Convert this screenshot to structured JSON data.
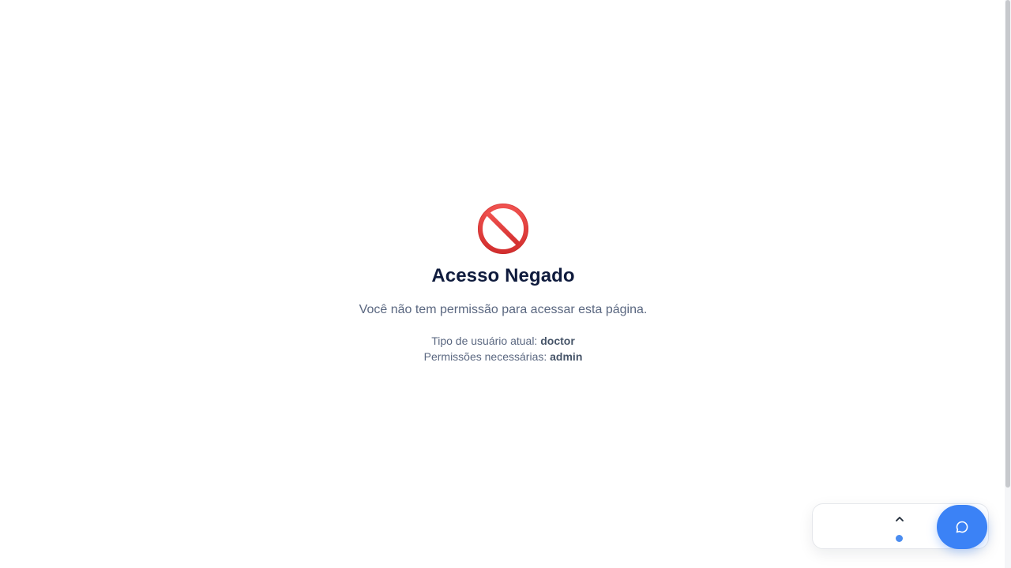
{
  "error": {
    "icon": "prohibited-icon",
    "title": "Acesso Negado",
    "message": "Você não tem permissão para acessar esta página.",
    "user_type_label": "Tipo de usuário atual:",
    "user_type_value": "doctor",
    "permissions_label": "Permissões necessárias:",
    "permissions_value": "admin"
  },
  "widget": {
    "expand_icon": "chevron-up-icon",
    "chat_icon": "chat-bubble-icon"
  },
  "colors": {
    "title": "#0f1b3d",
    "text": "#5a6780",
    "icon_red": "#e53935",
    "accent_blue": "#3b82f6"
  }
}
